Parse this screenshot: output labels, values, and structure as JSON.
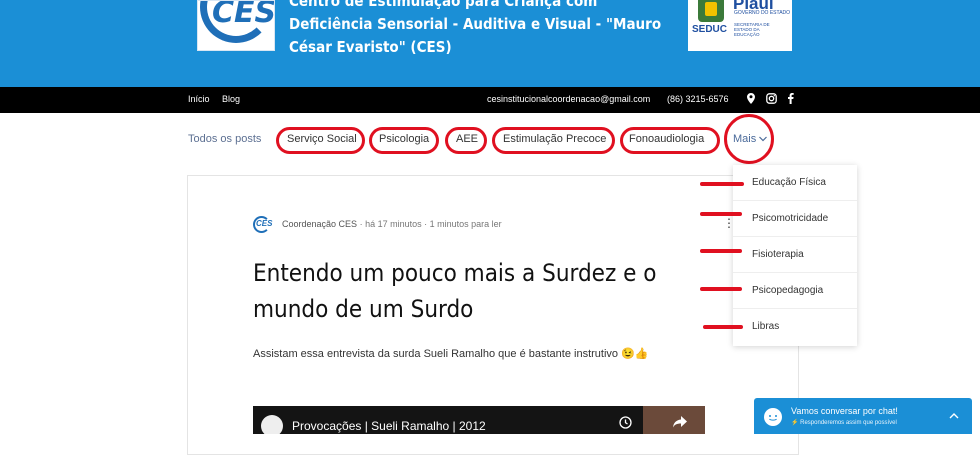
{
  "header": {
    "logo_text": "CES",
    "title": "Centro de Estimulação para Criança com Deficiência Sensorial - Auditiva e Visual - \"Mauro César Evaristo\" (CES)",
    "gov_logo": {
      "name": "Piauí",
      "gov": "GOVERNO DO ESTADO",
      "seduc": "SEDUC",
      "secretaria": "SECRETARIA DE ESTADO DA EDUCAÇÃO"
    },
    "background": "#1b8fd6"
  },
  "navbar": {
    "links": [
      "Início",
      "Blog"
    ],
    "email": "cesinstitucionalcoordenacao@gmail.com",
    "phone": "(86) 3215-6576",
    "icons": [
      "map-pin-icon",
      "instagram-icon",
      "facebook-icon"
    ]
  },
  "categories": {
    "all": "Todos os posts",
    "items": [
      "Serviço Social",
      "Psicologia",
      "AEE",
      "Estimulação Precoce",
      "Fonoaudiologia"
    ],
    "more": "Mais"
  },
  "post": {
    "author": "Coordenação CES",
    "time": "há 17 minutos",
    "read_time": "1 minutos para ler",
    "title": "Entendo um pouco mais a Surdez e o mundo de um Surdo",
    "excerpt": "Assistam essa entrevista da surda Sueli Ramalho que é bastante instrutivo 😉👍",
    "video_title": "Provocações | Sueli Ramalho | 2012"
  },
  "dropdown": {
    "items": [
      "Educação Física",
      "Psicomotricidade",
      "Fisioterapia",
      "Psicopedagogia",
      "Libras"
    ]
  },
  "chat": {
    "title": "Vamos conversar por chat!",
    "subtitle": "Responderemos assim que possível"
  },
  "annotation_color": "#e01020"
}
